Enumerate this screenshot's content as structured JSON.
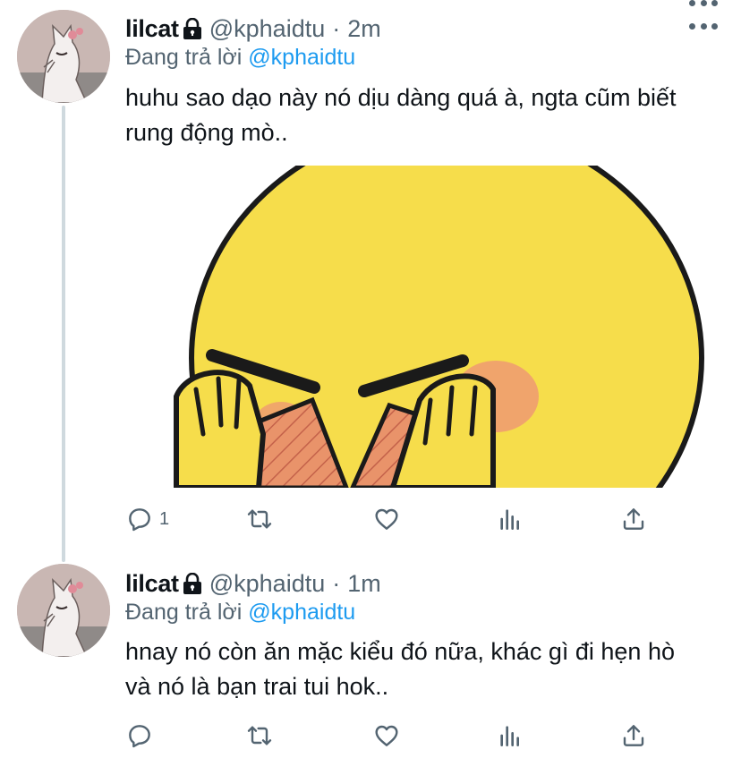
{
  "tweets": [
    {
      "name": "lilcat",
      "handle": "@kphaidtu",
      "separator": "·",
      "time": "2m",
      "replying_prefix": "Đang trả lời",
      "replying_to": "@kphaidtu",
      "text": "huhu sao dạo này nó dịu dàng quá à, ngta cũm biết rung động mò..",
      "reply_count": "1"
    },
    {
      "name": "lilcat",
      "handle": "@kphaidtu",
      "separator": "·",
      "time": "1m",
      "replying_prefix": "Đang trả lời",
      "replying_to": "@kphaidtu",
      "text": "hnay nó còn ăn mặc kiểu đó nữa, khác gì đi hẹn hò và nó là bạn trai tui hok..",
      "reply_count": ""
    }
  ],
  "icons": {
    "lock": "lock-icon",
    "more": "more-icon",
    "reply": "reply-icon",
    "retweet": "retweet-icon",
    "like": "heart-icon",
    "stats": "stats-icon",
    "share": "share-icon"
  },
  "colors": {
    "accent": "#1d9bf0",
    "secondary_text": "#536471",
    "thread_line": "#cfd9de",
    "emoji_yellow": "#f6dd4b",
    "blush": "#e98a5b"
  }
}
